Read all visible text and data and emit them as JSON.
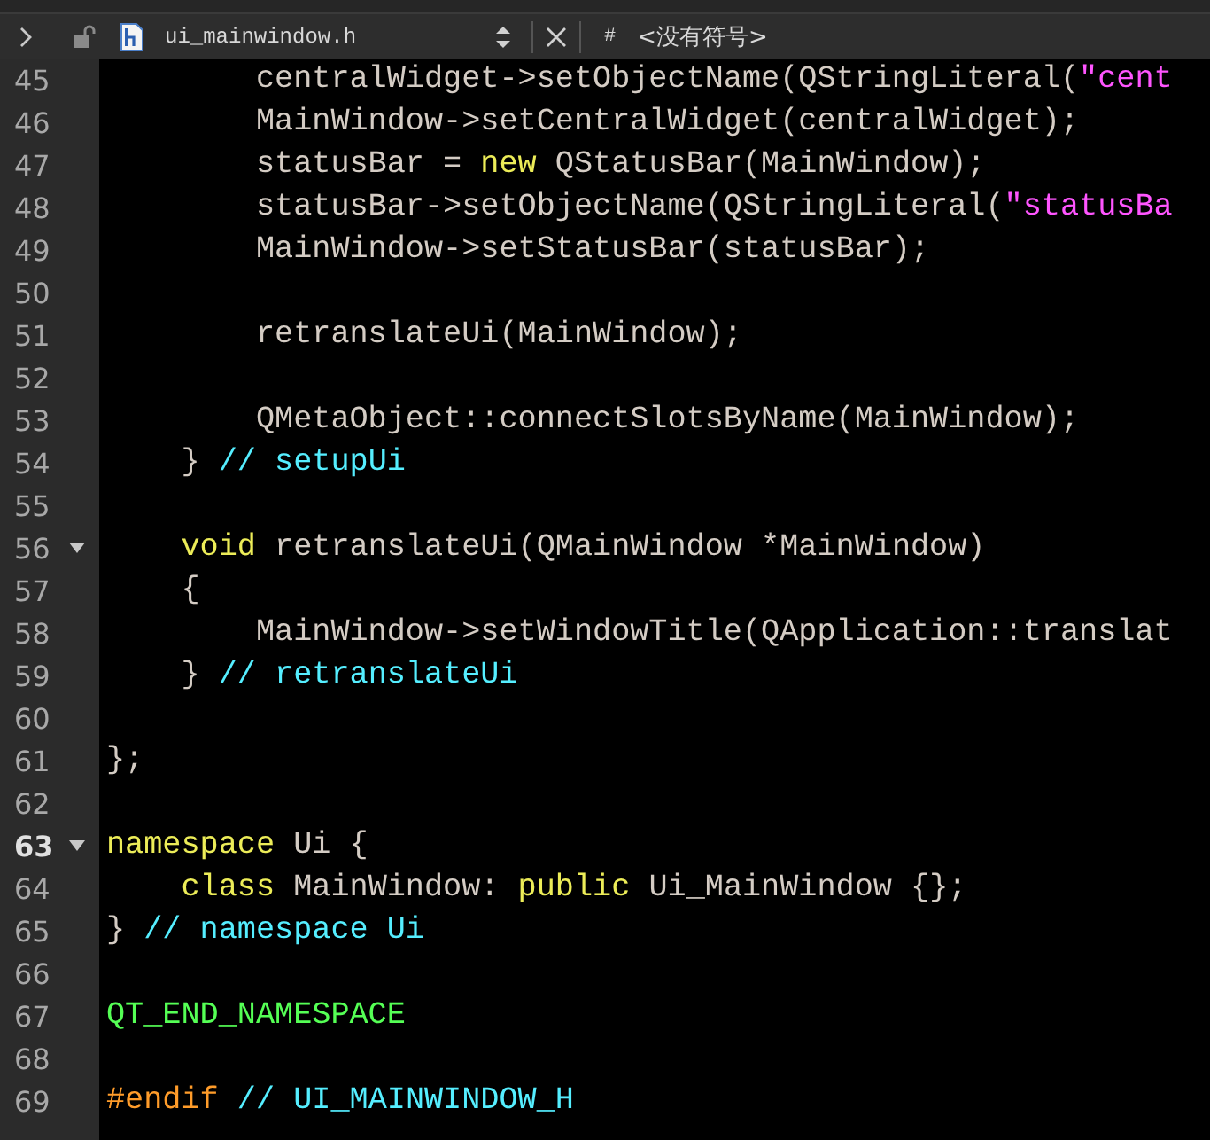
{
  "toolbar": {
    "file_name": "ui_mainwindow.h",
    "symbol_prefix": "#",
    "symbol": "<没有符号>"
  },
  "lines": [
    {
      "number": "45",
      "fold": false,
      "current": false,
      "tokens": [
        {
          "kind": "plain",
          "text": "        centralWidget->setObjectName(QStringLiteral("
        },
        {
          "kind": "string",
          "text": "\"cent"
        }
      ]
    },
    {
      "number": "46",
      "fold": false,
      "current": false,
      "tokens": [
        {
          "kind": "plain",
          "text": "        MainWindow->setCentralWidget(centralWidget);"
        }
      ]
    },
    {
      "number": "47",
      "fold": false,
      "current": false,
      "tokens": [
        {
          "kind": "plain",
          "text": "        statusBar = "
        },
        {
          "kind": "keyword",
          "text": "new"
        },
        {
          "kind": "plain",
          "text": " QStatusBar(MainWindow);"
        }
      ]
    },
    {
      "number": "48",
      "fold": false,
      "current": false,
      "tokens": [
        {
          "kind": "plain",
          "text": "        statusBar->setObjectName(QStringLiteral("
        },
        {
          "kind": "string",
          "text": "\"statusBa"
        }
      ]
    },
    {
      "number": "49",
      "fold": false,
      "current": false,
      "tokens": [
        {
          "kind": "plain",
          "text": "        MainWindow->setStatusBar(statusBar);"
        }
      ]
    },
    {
      "number": "50",
      "fold": false,
      "current": false
    },
    {
      "number": "51",
      "fold": false,
      "current": false,
      "tokens": [
        {
          "kind": "plain",
          "text": "        retranslateUi(MainWindow);"
        }
      ]
    },
    {
      "number": "52",
      "fold": false,
      "current": false
    },
    {
      "number": "53",
      "fold": false,
      "current": false,
      "tokens": [
        {
          "kind": "plain",
          "text": "        QMetaObject::connectSlotsByName(MainWindow);"
        }
      ]
    },
    {
      "number": "54",
      "fold": false,
      "current": false,
      "tokens": [
        {
          "kind": "plain",
          "text": "    } "
        },
        {
          "kind": "comment",
          "text": "// setupUi"
        }
      ]
    },
    {
      "number": "55",
      "fold": false,
      "current": false
    },
    {
      "number": "56",
      "fold": true,
      "current": false,
      "tokens": [
        {
          "kind": "keyword",
          "text": "    void"
        },
        {
          "kind": "plain",
          "text": " retranslateUi(QMainWindow *MainWindow)"
        }
      ]
    },
    {
      "number": "57",
      "fold": false,
      "current": false,
      "tokens": [
        {
          "kind": "plain",
          "text": "    {"
        }
      ]
    },
    {
      "number": "58",
      "fold": false,
      "current": false,
      "tokens": [
        {
          "kind": "plain",
          "text": "        MainWindow->setWindowTitle(QApplication::translat"
        }
      ]
    },
    {
      "number": "59",
      "fold": false,
      "current": false,
      "tokens": [
        {
          "kind": "plain",
          "text": "    } "
        },
        {
          "kind": "comment",
          "text": "// retranslateUi"
        }
      ]
    },
    {
      "number": "60",
      "fold": false,
      "current": false
    },
    {
      "number": "61",
      "fold": false,
      "current": false,
      "tokens": [
        {
          "kind": "plain",
          "text": "};"
        }
      ]
    },
    {
      "number": "62",
      "fold": false,
      "current": false
    },
    {
      "number": "63",
      "fold": true,
      "current": true,
      "tokens": [
        {
          "kind": "keyword",
          "text": "namespace"
        },
        {
          "kind": "plain",
          "text": " Ui {"
        }
      ]
    },
    {
      "number": "64",
      "fold": false,
      "current": false,
      "tokens": [
        {
          "kind": "keyword",
          "text": "    class"
        },
        {
          "kind": "plain",
          "text": " MainWindow: "
        },
        {
          "kind": "keyword",
          "text": "public"
        },
        {
          "kind": "plain",
          "text": " Ui_MainWindow {};"
        }
      ]
    },
    {
      "number": "65",
      "fold": false,
      "current": false,
      "tokens": [
        {
          "kind": "plain",
          "text": "} "
        },
        {
          "kind": "comment",
          "text": "// namespace Ui"
        }
      ]
    },
    {
      "number": "66",
      "fold": false,
      "current": false
    },
    {
      "number": "67",
      "fold": false,
      "current": false,
      "tokens": [
        {
          "kind": "macro",
          "text": "QT_END_NAMESPACE"
        }
      ]
    },
    {
      "number": "68",
      "fold": false,
      "current": false
    },
    {
      "number": "69",
      "fold": false,
      "current": false,
      "tokens": [
        {
          "kind": "preproc",
          "text": "#endif"
        },
        {
          "kind": "comment",
          "text": " // UI_MAINWINDOW_H"
        }
      ]
    }
  ]
}
